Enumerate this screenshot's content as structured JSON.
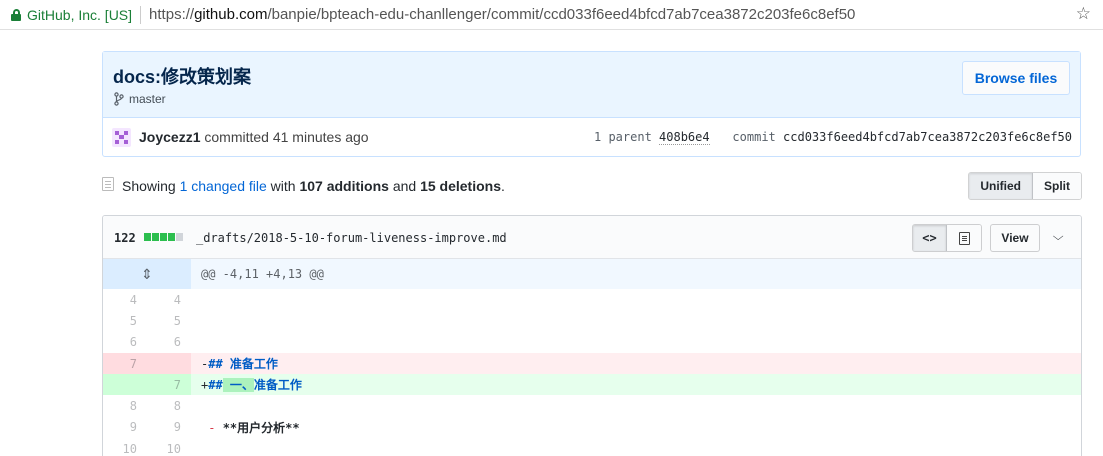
{
  "browser": {
    "site_identity": "GitHub, Inc. [US]",
    "url_scheme": "https://",
    "url_host": "github.com",
    "url_path": "/banpie/bpteach-edu-chanllenger/commit/ccd033f6eed4bfcd7ab7cea3872c203fe6c8ef50",
    "star_icon": "☆"
  },
  "commit": {
    "title": "docs:修改策划案",
    "branch": "master",
    "browse_label": "Browse files",
    "author": "Joycezz1",
    "action": "committed",
    "time": "41 minutes ago",
    "parent_label": "1 parent",
    "parent_sha": "408b6e4",
    "commit_label": "commit",
    "commit_sha": "ccd033f6eed4bfcd7ab7cea3872c203fe6c8ef50"
  },
  "toc": {
    "showing": "Showing",
    "changed_files": "1 changed file",
    "with": "with",
    "additions": "107 additions",
    "and": "and",
    "deletions": "15 deletions",
    "period": ".",
    "unified_label": "Unified",
    "split_label": "Split"
  },
  "file": {
    "diff_count": "122",
    "diffstat": {
      "additions": 4,
      "neutral": 1
    },
    "name": "_drafts/2018-5-10-forum-liveness-improve.md",
    "view_label": "View",
    "code_view_icon": "<>",
    "chevron": "⌄"
  },
  "diff": {
    "hunk_header": "@@ -4,11 +4,13 @@",
    "expand_icon": "⇕",
    "lines": [
      {
        "type": "context",
        "old": "4",
        "new": "4"
      },
      {
        "type": "context",
        "old": "5",
        "new": "5"
      },
      {
        "type": "context",
        "old": "6",
        "new": "6"
      },
      {
        "type": "del",
        "old": "7",
        "new": "",
        "sign": "-",
        "prefix": "##",
        "text": " 准备工作"
      },
      {
        "type": "add",
        "old": "",
        "new": "7",
        "sign": "+",
        "prefix": "##",
        "highlight": " 一、",
        "text": "准备工作"
      },
      {
        "type": "context",
        "old": "8",
        "new": "8"
      },
      {
        "type": "context",
        "old": "9",
        "new": "9",
        "list_marker": "-",
        "text": " **用户分析**"
      },
      {
        "type": "context",
        "old": "10",
        "new": "10"
      }
    ]
  },
  "colors": {
    "link": "#0366d6",
    "secure_green": "#1a7f37",
    "add_bg": "#e6ffed",
    "del_bg": "#ffeef0",
    "hunk_bg": "#f1f8ff"
  }
}
